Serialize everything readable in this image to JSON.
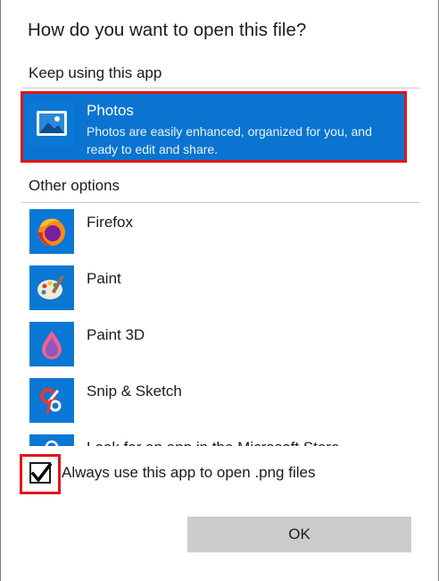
{
  "dialog": {
    "title": "How do you want to open this file?",
    "keep_using_label": "Keep using this app",
    "other_options_label": "Other options"
  },
  "selected_app": {
    "name": "Photos",
    "description": "Photos are easily enhanced, organized for you, and ready to edit and share.",
    "icon": "photos-icon"
  },
  "other_apps": [
    {
      "name": "Firefox",
      "icon": "firefox-icon"
    },
    {
      "name": "Paint",
      "icon": "paint-icon"
    },
    {
      "name": "Paint 3D",
      "icon": "paint-3d-icon"
    },
    {
      "name": "Snip & Sketch",
      "icon": "snip-sketch-icon"
    },
    {
      "name": "Look for an app in the Microsoft Store",
      "icon": "store-icon"
    }
  ],
  "always_use": {
    "label": "Always use this app to open .png files",
    "checked": true
  },
  "ok_button": {
    "label": "OK"
  },
  "colors": {
    "selection": "#0a74d0",
    "tile": "#0a78d4",
    "highlight_box": "#e0161b",
    "button": "#cccccc"
  }
}
